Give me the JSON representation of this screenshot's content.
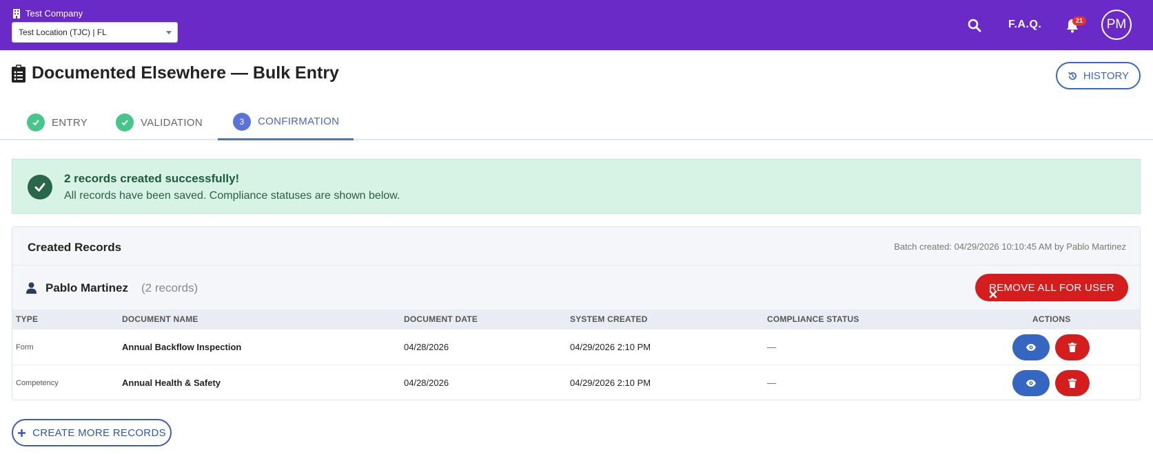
{
  "header": {
    "company_name": "Test Company",
    "location_selected": "Test Location (TJC) | FL",
    "faq_label": "F.A.Q.",
    "notification_count": "21",
    "avatar_initials": "PM",
    "brand_color": "#6a2ac8"
  },
  "page": {
    "title": "Documented Elsewhere — Bulk Entry",
    "history_label": "HISTORY"
  },
  "steps": [
    {
      "label": "ENTRY",
      "state": "done"
    },
    {
      "label": "VALIDATION",
      "state": "done"
    },
    {
      "label": "CONFIRMATION",
      "state": "active",
      "number": "3"
    }
  ],
  "alert": {
    "title": "2 records created successfully!",
    "message": "All records have been saved. Compliance statuses are shown below."
  },
  "records": {
    "title": "Created Records",
    "batch_info": "Batch created: 04/29/2026 10:10:45 AM by Pablo Martinez",
    "user_name": "Pablo Martinez",
    "user_count": "(2 records)",
    "remove_all_label": "REMOVE ALL FOR USER",
    "columns": [
      "TYPE",
      "DOCUMENT NAME",
      "DOCUMENT DATE",
      "SYSTEM CREATED",
      "COMPLIANCE STATUS",
      "ACTIONS"
    ],
    "rows": [
      {
        "type": "Form",
        "document_name": "Annual Backflow Inspection",
        "document_date": "04/28/2026",
        "system_created": "04/29/2026 2:10 PM",
        "compliance_status": "—"
      },
      {
        "type": "Competency",
        "document_name": "Annual Health & Safety",
        "document_date": "04/28/2026",
        "system_created": "04/29/2026 2:10 PM",
        "compliance_status": "—"
      }
    ]
  },
  "footer": {
    "create_more_label": "CREATE MORE RECORDS"
  }
}
